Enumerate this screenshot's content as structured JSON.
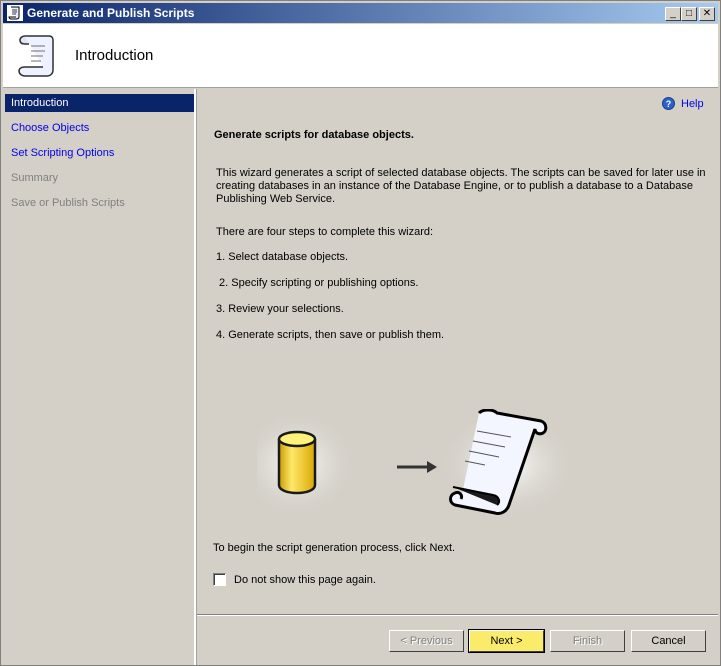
{
  "window": {
    "title": "Generate and Publish Scripts"
  },
  "header": {
    "title": "Introduction"
  },
  "sidebar": {
    "items": [
      {
        "label": "Introduction"
      },
      {
        "label": "Choose Objects"
      },
      {
        "label": "Set Scripting Options"
      },
      {
        "label": "Summary"
      },
      {
        "label": "Save or Publish Scripts"
      }
    ]
  },
  "main": {
    "help_label": "Help",
    "heading": "Generate scripts for database objects.",
    "description": "This wizard generates a script of selected database objects. The scripts can be saved for later use in creating databases in an instance of the Database Engine, or to publish a database to a Database Publishing Web Service.",
    "steps_intro": "There are four steps to complete this wizard:",
    "steps": [
      "1. Select database objects.",
      " 2. Specify scripting or publishing options.",
      "3. Review your selections.",
      "4. Generate scripts, then save or publish them."
    ],
    "begin_text": "To begin the script generation process, click Next.",
    "checkbox_label": "Do not show this page again."
  },
  "buttons": {
    "previous": "< Previous",
    "next": "Next >",
    "finish": "Finish",
    "cancel": "Cancel"
  },
  "colors": {
    "title_bar": "#0a246a",
    "default_button": "#fbeb6a",
    "link": "#0000ee"
  }
}
